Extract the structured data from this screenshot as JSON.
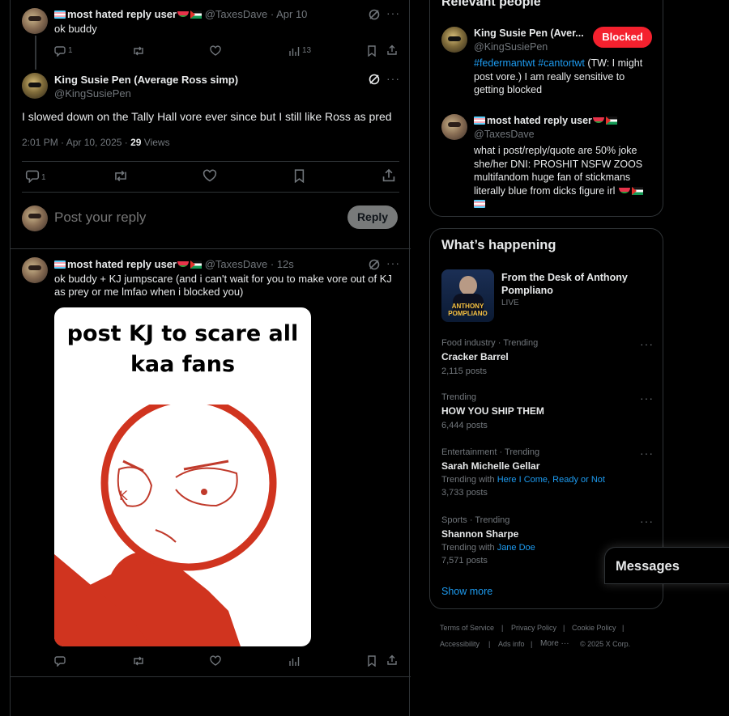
{
  "parent_tweet": {
    "author_name": "most hated reply user",
    "author_handle": "@TaxesDave",
    "date": "· Apr 10",
    "text": "ok buddy",
    "reply_count": "1",
    "views": "13"
  },
  "main_tweet": {
    "author_name": "King Susie Pen (Average Ross simp)",
    "author_handle": "@KingSusiePen",
    "text": "I slowed down on the Tally Hall vore ever since but I still like Ross as pred",
    "timestamp": "2:01 PM · Apr 10, 2025 ·",
    "views_count": "29",
    "views_label": "Views",
    "reply_count": "1"
  },
  "composer": {
    "placeholder": "Post your reply",
    "reply_button": "Reply"
  },
  "reply_tweet": {
    "author_name": "most hated reply user",
    "author_handle": "@TaxesDave",
    "date": "· 12s",
    "text": "ok buddy + KJ jumpscare (and i can't wait for you to make vore out of KJ as prey or me lmfao when i blocked you)",
    "image_caption_line1": "post KJ to scare all",
    "image_caption_line2": "kaa fans"
  },
  "relevant_people": {
    "heading": "Relevant people",
    "people": [
      {
        "name": "King Susie Pen (Aver...",
        "handle": "@KingSusiePen",
        "button": "Blocked",
        "bio_tag1": "#federmantwt",
        "bio_tag2": "#cantortwt",
        "bio_rest": " (TW: I might post vore.) I am really sensitive to getting blocked"
      },
      {
        "name": "most hated reply user",
        "handle": "@TaxesDave",
        "bio": "what i post/reply/quote are 50% joke she/her DNI: PROSHIT NSFW ZOOS multifandom huge fan of stickmans literally blue from dicks figure irl"
      }
    ]
  },
  "whats_happening": {
    "heading": "What’s happening",
    "featured": {
      "title": "From the Desk of Anthony Pompliano",
      "status": "LIVE",
      "thumb_text_1": "ANTHONY",
      "thumb_text_2": "POMPLIANO"
    },
    "trends": [
      {
        "meta": "Food industry · Trending",
        "title": "Cracker Barrel",
        "posts": "2,115 posts",
        "with_label": "",
        "with_link": ""
      },
      {
        "meta": "Trending",
        "title": "HOW YOU SHIP THEM",
        "posts": "6,444 posts",
        "with_label": "",
        "with_link": ""
      },
      {
        "meta": "Entertainment · Trending",
        "title": "Sarah Michelle Gellar",
        "posts": "3,733 posts",
        "with_label": "Trending with",
        "with_link": "Here I Come, Ready or Not"
      },
      {
        "meta": "Sports · Trending",
        "title": "Shannon Sharpe",
        "posts": "7,571 posts",
        "with_label": "Trending with",
        "with_link": "Jane Doe"
      }
    ],
    "show_more": "Show more"
  },
  "footer": {
    "links": [
      "Terms of Service",
      "Privacy Policy",
      "Cookie Policy",
      "Accessibility",
      "Ads info",
      "More ···"
    ],
    "copyright": "© 2025 X Corp."
  },
  "messages_drawer": {
    "label": "Messages"
  },
  "colors": {
    "accent": "#1d9bf0",
    "blocked": "#f4212e",
    "muted": "#71767b",
    "border": "#2f3336"
  }
}
